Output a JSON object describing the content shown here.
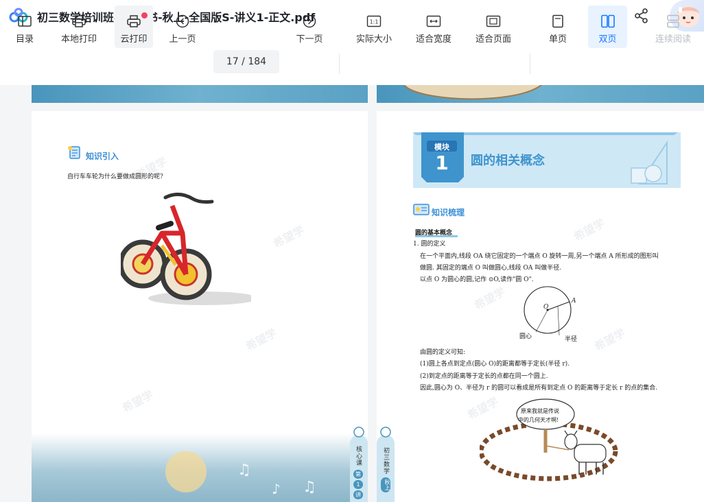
{
  "title_bar": {
    "file_name": "初三数学培训班学习用书-秋上-全国版S-讲义1-正文.pdf",
    "download_icon": "download-icon",
    "share_icon": "share-icon",
    "avatar_icon": "avatar-icon"
  },
  "toolbar": {
    "toc": "目录",
    "local_print": "本地打印",
    "cloud_print": "云打印",
    "prev_page": "上一页",
    "page_current": "17",
    "page_total": "184",
    "page_separator": " / ",
    "next_page": "下一页",
    "actual_size": "实际大小",
    "actual_size_icon_text": "1:1",
    "fit_width": "适合宽度",
    "fit_page": "适合页面",
    "single_page": "单页",
    "double_page": "双页",
    "continuous": "连续阅读",
    "accent_color": "#1677ff",
    "notification_color": "#f53f5f"
  },
  "left_page": {
    "section_title": "知识引入",
    "question": "自行车车轮为什么要做成圆形的呢?",
    "watermark": "希望学",
    "side_tab_text": "核心课",
    "side_tab_badge_1": "第",
    "side_tab_badge_2": "1",
    "side_tab_badge_3": "讲"
  },
  "right_page": {
    "module_label": "模块",
    "module_number": "1",
    "module_title": "圆的相关概念",
    "section_title": "知识梳理",
    "heading": "圆的基本概念",
    "item1": "1. 圆的定义",
    "def_line1": "在一个平面内,线段 OA 绕它固定的一个端点 O 旋转一周,另一个端点 A 所形成的图形叫",
    "def_line2": "做圆. 其固定的端点 O 叫做圆心,线段 OA 叫做半径.",
    "def_line3": "以点 O 为圆心的圆,记作 ⊙O,读作\"圆 O\".",
    "fig_label_o": "O",
    "fig_label_a": "A",
    "fig_label_center": "圆心",
    "fig_label_radius": "半径",
    "known": "由圆的定义可知:",
    "point1": "(1)圆上各点到定点(圆心 O)的距离都等于定长(半径 r).",
    "point2": "(2)到定点的距离等于定长的点都在同一个圆上.",
    "conclusion": "因此,圆心为 O、半径为 r 的圆可以看成是所有到定点 O 的距离等于定长 r 的点的集合.",
    "bubble_line1": "原来我就是传说",
    "bubble_line2": "中的几何天才啊!",
    "watermark": "希望学",
    "side_tab_text": "初三数学",
    "side_tab_badge": "秋上"
  }
}
